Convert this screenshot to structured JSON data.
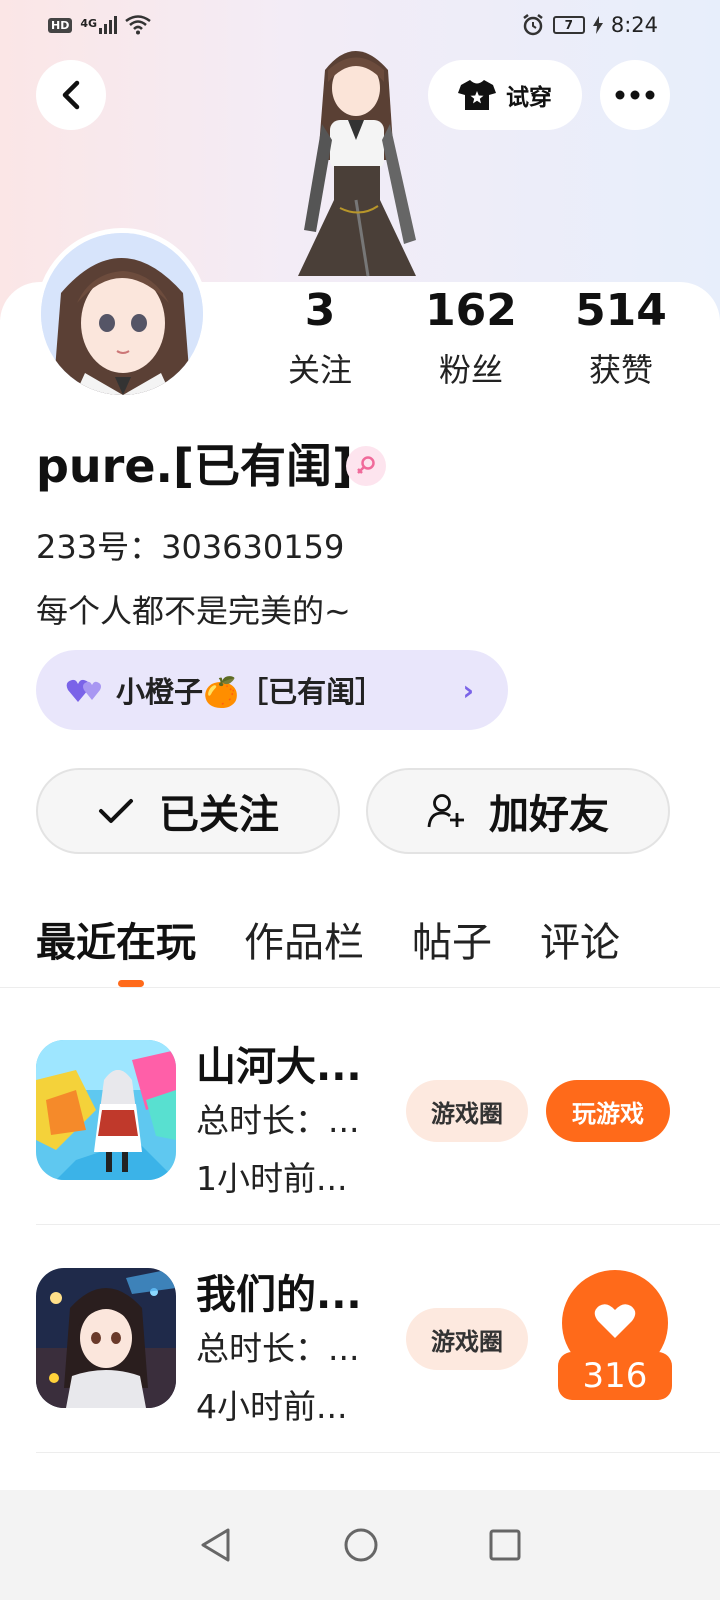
{
  "status_bar": {
    "network": "4G",
    "battery": "7",
    "time": "8:24"
  },
  "header": {
    "try_on_label": "试穿"
  },
  "profile": {
    "stats": [
      {
        "value": "3",
        "label": "关注"
      },
      {
        "value": "162",
        "label": "粉丝"
      },
      {
        "value": "514",
        "label": "获赞"
      }
    ],
    "username": "pure.[已有闺]",
    "id_line": "233号：303630159",
    "bio": "每个人都不是完美的~",
    "cp_chip": "小橙子🍊［已有闺］"
  },
  "actions": {
    "follow_label": "已关注",
    "add_friend_label": "加好友"
  },
  "tabs": [
    "最近在玩",
    "作品栏",
    "帖子",
    "评论"
  ],
  "games": [
    {
      "title": "山河大...",
      "duration": "总时长：...",
      "last_played": "1小时前...",
      "circle_label": "游戏圈",
      "play_label": "玩游戏"
    },
    {
      "title": "我们的...",
      "duration": "总时长：...",
      "last_played": "4小时前...",
      "circle_label": "游戏圈"
    }
  ],
  "like_float": {
    "count": "316"
  },
  "colors": {
    "accent": "#ff6a1a",
    "chip_bg": "#e9e6fb",
    "pill_bg": "#fde9df"
  }
}
